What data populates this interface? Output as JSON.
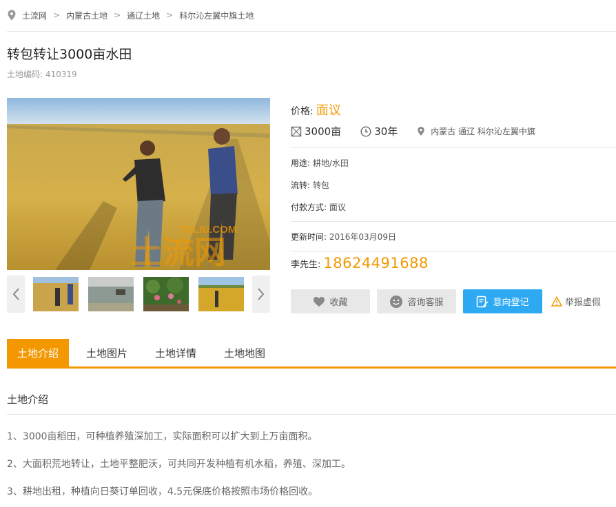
{
  "breadcrumb": {
    "items": [
      "土流网",
      "内蒙古土地",
      "通辽土地",
      "科尔沁左翼中旗土地"
    ],
    "separator": ">"
  },
  "listing": {
    "title": "转包转让3000亩水田",
    "code_label": "土地编码:",
    "code_value": "410319"
  },
  "gallery": {
    "watermark_brand": "TULIU.COM",
    "watermark_cn": "土流网"
  },
  "info": {
    "price_label": "价格:",
    "price_value": "面议",
    "area": "3000亩",
    "term": "30年",
    "location": "内蒙古 通辽 科尔沁左翼中旗",
    "usage_label": "用途:",
    "usage_value": "耕地/水田",
    "transfer_label": "流转:",
    "transfer_value": "转包",
    "payment_label": "付款方式:",
    "payment_value": "面议",
    "updated_label": "更新时间:",
    "updated_value": "2016年03月09日",
    "contact_label": "李先生:",
    "contact_phone": "18624491688"
  },
  "actions": {
    "favorite": "收藏",
    "consult": "咨询客服",
    "intent": "意向登记",
    "report": "举报虚假"
  },
  "tabs": [
    "土地介绍",
    "土地图片",
    "土地详情",
    "土地地图"
  ],
  "intro": {
    "heading": "土地介绍",
    "paragraphs": [
      "1、3000亩稻田，可种植养殖深加工，实际面积可以扩大到上万亩面积。",
      "2、大面积荒地转让，土地平整肥沃，可共同开发种植有机水稻，养殖、深加工。",
      "3、耕地出租，种植向日葵订单回收，4.5元保底价格按照市场价格回收。"
    ]
  },
  "colors": {
    "accent": "#f39800",
    "button_blue": "#2eaaf3",
    "button_gray": "#e8e8e8"
  }
}
